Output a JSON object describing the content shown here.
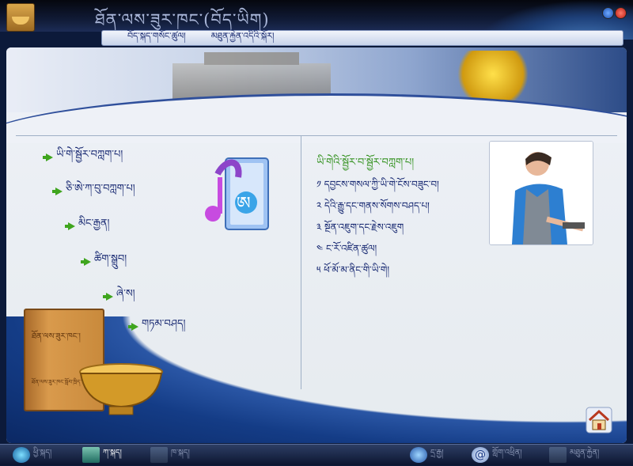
{
  "window": {
    "title": "ཐོན་ལས་ཟུར་ཁང་(བོད་ཡིག)"
  },
  "menubar": {
    "items": [
      "བོད་སྐད་གསོང་ཚུལ།",
      "མཐུན་རྐྱེན་འདིའི་སྐོར།"
    ]
  },
  "nav": {
    "items": [
      "ཡི་གེ་སྦྱོར་བཀླག་པ།",
      "ཅི་ཨེ་ཀ་བུ་བཀླག་པ།",
      "མིང་རྒྱན།",
      "ཚིག་སྒྲུབ།",
      "ཞེ་ས།",
      "གཏམ་བཤད།"
    ]
  },
  "right_panel": {
    "title": "ཡི་གེའི་སྦྱོར་བ་སྦྱོར་བཀླག་པ།",
    "items": [
      "༡ དབྱངས་གསལ་ཀྱི་ཡི་གེ་ངོས་བཟུང་བ།",
      "༢ དེའི་རྒྱུ་དང་གནས་སོགས་བཤད་པ།",
      "༣ སྔོན་འཇུག་དང་རྗེས་འཇུག",
      "༤ ང་རོ་འཛིན་ཚུལ།",
      "༥ ཕོ་མོ་མ་ནིང་གི་ཡི་གེ།"
    ]
  },
  "book": {
    "title": "ཐོན་ལས་ཟུར་ཁང་།",
    "subtitle": "ཐོན་ལས་ཟུར་ཁང་སློབ་ཁྲིད་"
  },
  "taskbar": {
    "items": [
      {
        "label": "ཕྱི་སྐད།",
        "active": false
      },
      {
        "label": "ཀ་སྐད།",
        "active": true
      },
      {
        "label": "ཁ་སྐད།",
        "active": false
      },
      {
        "label": "དྲ་རྒྱ།",
        "active": false
      },
      {
        "label": "གློག་འཕྲིན།",
        "active": false
      },
      {
        "label": "མཐུན་རྐྱེན།",
        "active": false
      }
    ]
  },
  "colors": {
    "accent_green": "#3fa51e",
    "nav_text": "#0b1d6a",
    "frame_blue": "#143c86"
  },
  "icons": {
    "app_logo": "bowl-logo-icon",
    "music_folder": "music-note-folder-icon",
    "home": "home-icon"
  }
}
